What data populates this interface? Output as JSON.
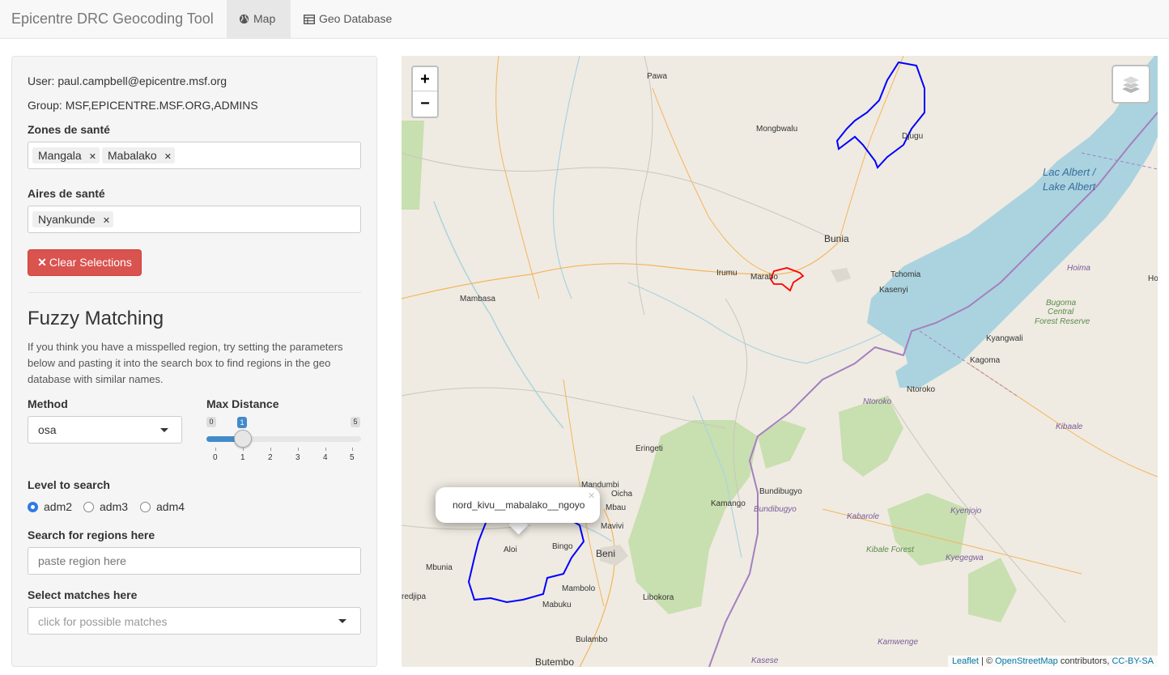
{
  "navbar": {
    "brand": "Epicentre DRC Geocoding Tool",
    "tabs": [
      {
        "label": "Map",
        "icon": "globe-icon",
        "active": true
      },
      {
        "label": "Geo Database",
        "icon": "table-icon",
        "active": false
      }
    ]
  },
  "sidebar": {
    "user": "User: paul.campbell@epicentre.msf.org",
    "group": "Group: MSF,EPICENTRE.MSF.ORG,ADMINS",
    "zones_label": "Zones de santé",
    "zones_selected": [
      "Mangala",
      "Mabalako"
    ],
    "aires_label": "Aires de santé",
    "aires_selected": [
      "Nyankunde"
    ],
    "clear_button": "Clear Selections",
    "fuzzy_title": "Fuzzy Matching",
    "fuzzy_help": "If you think you have a misspelled region, try setting the parameters below and pasting it into the search box to find regions in the geo database with similar names.",
    "method_label": "Method",
    "method_value": "osa",
    "max_distance_label": "Max Distance",
    "slider": {
      "min": 0,
      "max": 5,
      "value": 1,
      "ticks": [
        "0",
        "1",
        "2",
        "3",
        "4",
        "5"
      ],
      "min_label": "0",
      "max_label": "5",
      "value_label": "1"
    },
    "level_label": "Level to search",
    "levels": [
      {
        "label": "adm2",
        "checked": true
      },
      {
        "label": "adm3",
        "checked": false
      },
      {
        "label": "adm4",
        "checked": false
      }
    ],
    "search_label": "Search for regions here",
    "search_placeholder": "paste region here",
    "matches_label": "Select matches here",
    "matches_placeholder": "click for possible matches"
  },
  "map": {
    "zoom_in": "+",
    "zoom_out": "−",
    "popup_text": "nord_kivu__mabalako__ngoyo",
    "popup_close": "×",
    "labels": {
      "pawa": "Pawa",
      "mongbwalu": "Mongbwalu",
      "djugu": "Djugu",
      "lac_albert_1": "Lac Albert /",
      "lac_albert_2": "Lake Albert",
      "bunia": "Bunia",
      "irumu": "Irumu",
      "marabo": "Marabo",
      "tchomia": "Tchomia",
      "kasenyi": "Kasenyi",
      "hoima": "Hoima",
      "ho": "Ho",
      "bugoma_1": "Bugoma",
      "bugoma_2": "Central",
      "bugoma_3": "Forest Reserve",
      "mambasa": "Mambasa",
      "kyangwali": "Kyangwali",
      "kagoma": "Kagoma",
      "ntoroko": "Ntoroko",
      "ntoroko_ug": "Ntoroko",
      "kibaale": "Kibaale",
      "eringeti": "Eringeti",
      "mandumbi": "Mandumbi",
      "oicha": "Oicha",
      "mbau": "Mbau",
      "mavivi": "Mavivi",
      "kamango": "Kamango",
      "bundibugyo": "Bundibugyo",
      "bundibugyo_ug": "Bundibugyo",
      "kabarole": "Kabarole",
      "kyenjojo": "Kyenjojo",
      "aloi": "Aloi",
      "bingo": "Bingo",
      "beni": "Beni",
      "mbunia": "Mbunia",
      "kibale_forest": "Kibale Forest",
      "kyegegwa": "Kyegegwa",
      "redjipa": "redjipa",
      "mambolo": "Mambolo",
      "mabuku": "Mabuku",
      "libokora": "Libokora",
      "kamwenge": "Kamwenge",
      "bulambo": "Bulambo",
      "butembo": "Butembo",
      "kasese": "Kasese"
    },
    "attribution": {
      "leaflet": "Leaflet",
      "sep": "| ©",
      "osm": "OpenStreetMap",
      "contrib": "contributors,",
      "license": "CC-BY-SA"
    },
    "colors": {
      "land": "#efebe2",
      "water": "#aad3df",
      "park": "#c8dfb0",
      "zone_outline": "#0000ff",
      "aire_outline": "#ff0000",
      "border": "#a57fbf"
    }
  },
  "colors": {
    "danger": "#d9534f",
    "accent": "#2f7ae5"
  }
}
